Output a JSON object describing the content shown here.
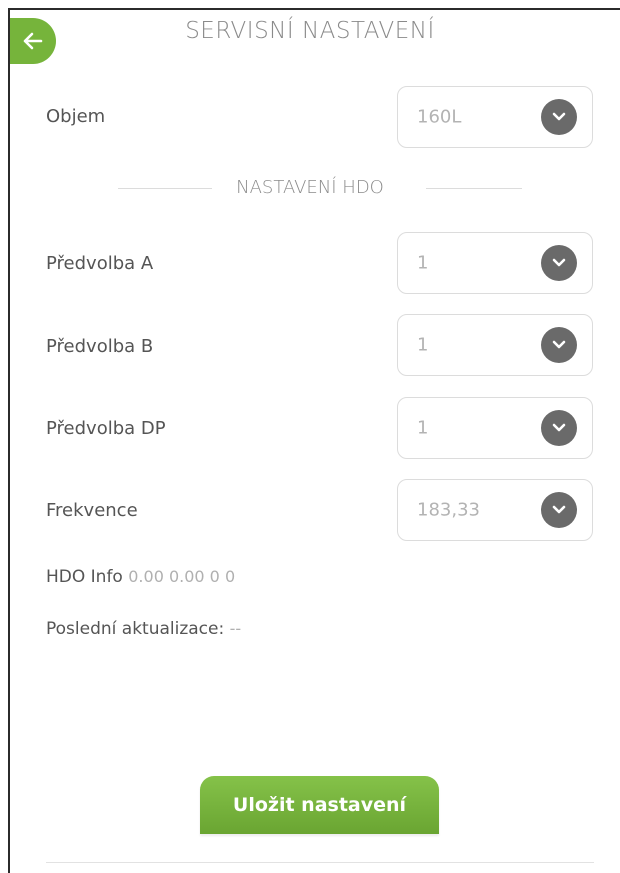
{
  "header": {
    "title": "SERVISNÍ NASTAVENÍ"
  },
  "volume": {
    "label": "Objem",
    "value": "160L"
  },
  "hdo_section": {
    "title": "NASTAVENÍ HDO"
  },
  "fields": [
    {
      "label": "Předvolba A",
      "value": "1"
    },
    {
      "label": "Předvolba B",
      "value": "1"
    },
    {
      "label": "Předvolba DP",
      "value": "1"
    },
    {
      "label": "Frekvence",
      "value": "183,33"
    }
  ],
  "hdo_info": {
    "label": "HDO Info",
    "value": "0.00 0.00 0 0"
  },
  "last_update": {
    "label": "Poslední aktualizace:",
    "value": "--"
  },
  "save_button": {
    "label": "Uložit nastavení"
  },
  "colors": {
    "accent": "#76b43b",
    "chevron": "#6a6a6a"
  }
}
